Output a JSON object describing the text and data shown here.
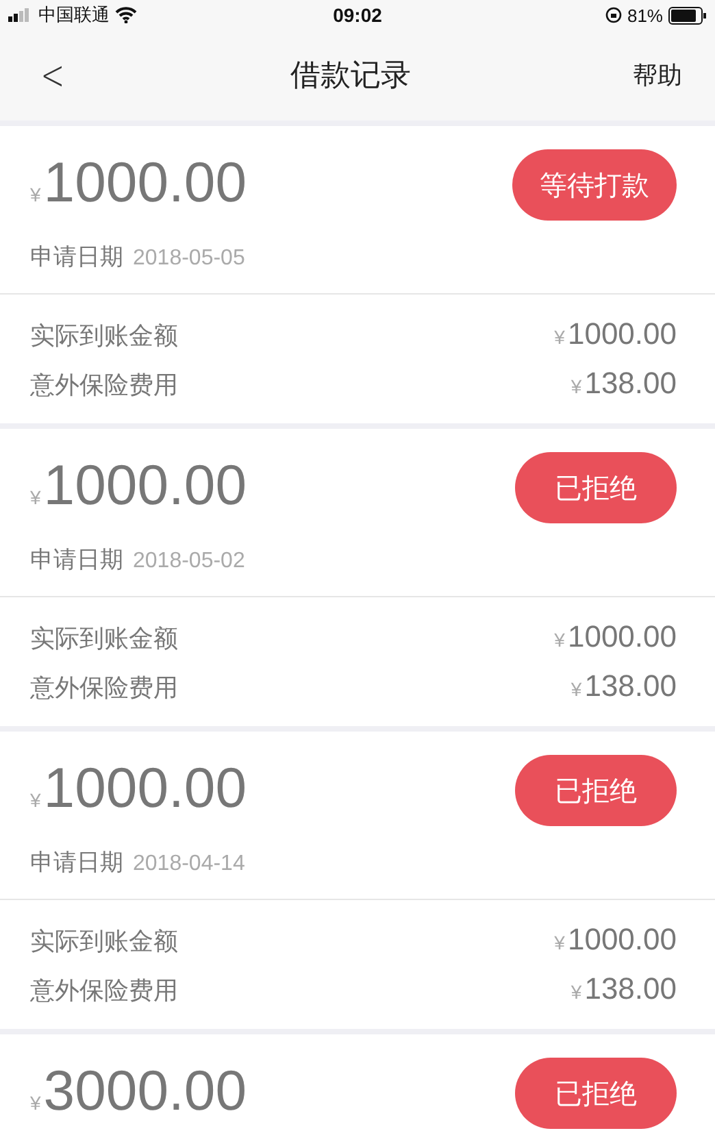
{
  "status_bar": {
    "carrier": "中国联通",
    "time": "09:02",
    "battery": "81%"
  },
  "nav": {
    "back": "<",
    "title": "借款记录",
    "help": "帮助"
  },
  "records": [
    {
      "currency": "¥",
      "amount": "1000.00",
      "status": "等待打款",
      "date_label": "申请日期",
      "date": "2018-05-05",
      "details": [
        {
          "label": "实际到账金额",
          "currency": "¥",
          "value": "1000.00"
        },
        {
          "label": "意外保险费用",
          "currency": "¥",
          "value": "138.00"
        }
      ]
    },
    {
      "currency": "¥",
      "amount": "1000.00",
      "status": "已拒绝",
      "date_label": "申请日期",
      "date": "2018-05-02",
      "details": [
        {
          "label": "实际到账金额",
          "currency": "¥",
          "value": "1000.00"
        },
        {
          "label": "意外保险费用",
          "currency": "¥",
          "value": "138.00"
        }
      ]
    },
    {
      "currency": "¥",
      "amount": "1000.00",
      "status": "已拒绝",
      "date_label": "申请日期",
      "date": "2018-04-14",
      "details": [
        {
          "label": "实际到账金额",
          "currency": "¥",
          "value": "1000.00"
        },
        {
          "label": "意外保险费用",
          "currency": "¥",
          "value": "138.00"
        }
      ]
    },
    {
      "currency": "¥",
      "amount": "3000.00",
      "status": "已拒绝"
    }
  ]
}
